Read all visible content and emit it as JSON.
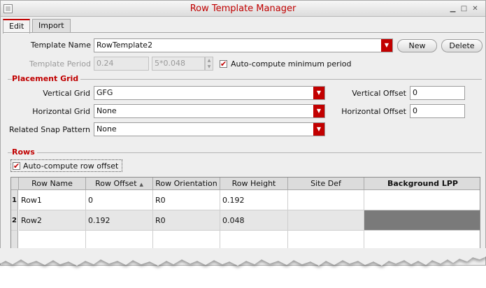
{
  "window": {
    "title": "Row Template Manager"
  },
  "tabs": [
    {
      "label": "Edit",
      "active": true
    },
    {
      "label": "Import",
      "active": false
    }
  ],
  "template": {
    "name_label": "Template Name",
    "name_value": "RowTemplate2",
    "new_label": "New",
    "delete_label": "Delete",
    "period_label": "Template Period",
    "period_value": "0.24",
    "period_expr": "5*0.048",
    "auto_period_label": "Auto-compute minimum period",
    "auto_period_checked": true
  },
  "placement_grid": {
    "title": "Placement Grid",
    "vertical_grid_label": "Vertical Grid",
    "vertical_grid_value": "GFG",
    "horizontal_grid_label": "Horizontal Grid",
    "horizontal_grid_value": "None",
    "snap_label": "Related Snap Pattern",
    "snap_value": "None",
    "vertical_offset_label": "Vertical Offset",
    "vertical_offset_value": "0",
    "horizontal_offset_label": "Horizontal Offset",
    "horizontal_offset_value": "0"
  },
  "rows": {
    "title": "Rows",
    "auto_offset_label": "Auto-compute row offset",
    "auto_offset_checked": true,
    "columns": [
      "Row Name",
      "Row Offset",
      "Row Orientation",
      "Row Height",
      "Site Def",
      "Background LPP"
    ],
    "items": [
      {
        "num": "1",
        "name": "Row1",
        "offset": "0",
        "orientation": "R0",
        "height": "0.192",
        "site": "",
        "lpp": ""
      },
      {
        "num": "2",
        "name": "Row2",
        "offset": "0.192",
        "orientation": "R0",
        "height": "0.048",
        "site": "",
        "lpp": ""
      }
    ]
  },
  "colors": {
    "accent": "#c00000",
    "selected_row": "#e6e6e6",
    "lpp_swatch": "#7a7a7a"
  },
  "icons": {
    "checkbox": "checkmark",
    "combo": "triangle-down",
    "sort": "triangle-up"
  }
}
